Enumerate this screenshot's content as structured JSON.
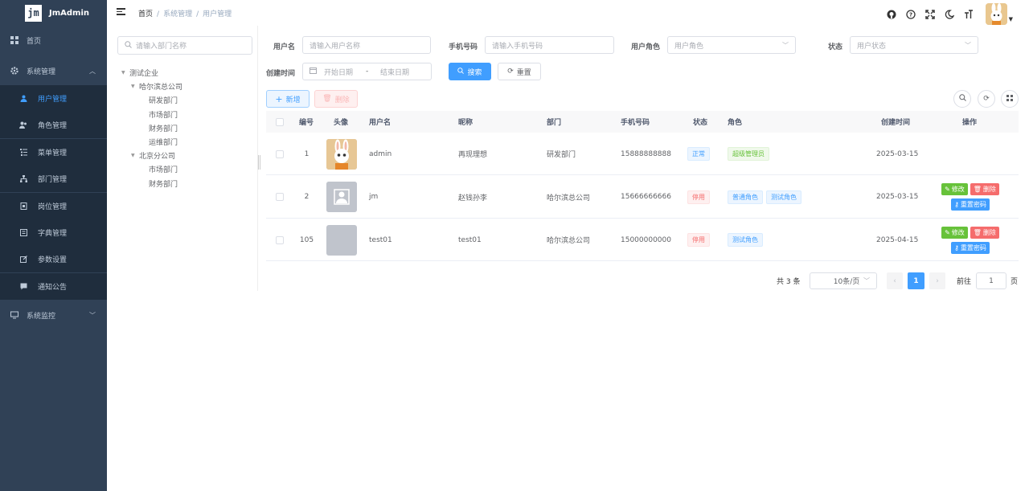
{
  "app": {
    "name": "JmAdmin",
    "logo_text": "jm"
  },
  "sidebar": {
    "home": "首页",
    "system": "系统管理",
    "items": [
      {
        "label": "用户管理",
        "icon": "user-icon",
        "active": true
      },
      {
        "label": "角色管理",
        "icon": "role-icon"
      },
      {
        "label": "菜单管理",
        "icon": "menu-tree-icon"
      },
      {
        "label": "部门管理",
        "icon": "dept-icon"
      },
      {
        "label": "岗位管理",
        "icon": "post-icon"
      },
      {
        "label": "字典管理",
        "icon": "dict-icon"
      },
      {
        "label": "参数设置",
        "icon": "edit-icon"
      },
      {
        "label": "通知公告",
        "icon": "message-icon"
      }
    ],
    "monitor": "系统监控"
  },
  "breadcrumb": {
    "home": "首页",
    "section": "系统管理",
    "page": "用户管理"
  },
  "tree": {
    "search_placeholder": "请输入部门名称",
    "nodes": [
      "测试企业",
      "哈尔滨总公司",
      "研发部门",
      "市场部门",
      "财务部门",
      "运维部门",
      "北京分公司",
      "市场部门",
      "财务部门"
    ]
  },
  "filters": {
    "username_label": "用户名",
    "username_placeholder": "请输入用户名称",
    "phone_label": "手机号码",
    "phone_placeholder": "请输入手机号码",
    "role_label": "用户角色",
    "role_placeholder": "用户角色",
    "status_label": "状态",
    "status_placeholder": "用户状态",
    "created_label": "创建时间",
    "start_placeholder": "开始日期",
    "date_sep": "-",
    "end_placeholder": "结束日期",
    "search_btn": "搜索",
    "reset_btn": "重置"
  },
  "toolbar": {
    "add": "新增",
    "delete": "删除"
  },
  "table": {
    "headers": [
      "编号",
      "头像",
      "用户名",
      "昵称",
      "部门",
      "手机号码",
      "状态",
      "角色",
      "创建时间",
      "操作"
    ],
    "rows": [
      {
        "id": "1",
        "username": "admin",
        "nickname": "再现理想",
        "dept": "研发部门",
        "phone": "15888888888",
        "status": "正常",
        "roles": [
          "超级管理员"
        ],
        "created": "2025-03-15",
        "avatar": "rabbit"
      },
      {
        "id": "2",
        "username": "jm",
        "nickname": "赵钱孙李",
        "dept": "哈尔滨总公司",
        "phone": "15666666666",
        "status": "停用",
        "roles": [
          "普通角色",
          "测试角色"
        ],
        "created": "2025-03-15",
        "avatar": "default"
      },
      {
        "id": "105",
        "username": "test01",
        "nickname": "test01",
        "dept": "哈尔滨总公司",
        "phone": "15000000000",
        "status": "停用",
        "roles": [
          "测试角色"
        ],
        "created": "2025-04-15",
        "avatar": "blank"
      }
    ],
    "ops": {
      "edit": "修改",
      "delete": "删除",
      "reset": "重置密码"
    }
  },
  "pager": {
    "total": "共 3 条",
    "size": "10条/页",
    "current": "1",
    "goto": "前往",
    "goto_value": "1",
    "page": "页"
  }
}
